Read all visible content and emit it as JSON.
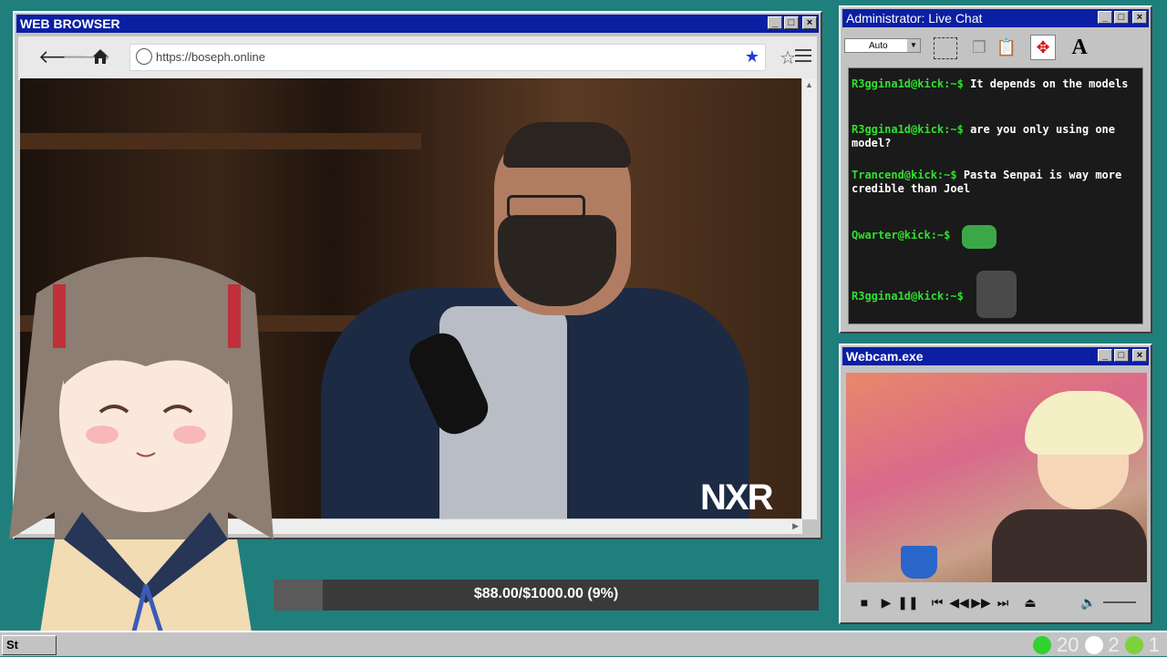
{
  "browser": {
    "title": "WEB BROWSER",
    "url": "https://boseph.online",
    "video_watermark": "NXR"
  },
  "donation": {
    "text": "$88.00/$1000.00 (9%)",
    "fraction": 0.09
  },
  "chat": {
    "title": "Administrator: Live Chat",
    "select_value": "Auto",
    "messages": [
      {
        "user": "R3ggina1d@kick:~$",
        "text": "It depends on the models"
      },
      {
        "user": "R3ggina1d@kick:~$",
        "text": "are you only using one model?"
      },
      {
        "user": "Trancend@kick:~$",
        "text": "Pasta Senpai is way more credible than Joel"
      },
      {
        "user": "Qwarter@kick:~$",
        "text": ""
      },
      {
        "user": "R3ggina1d@kick:~$",
        "text": ""
      }
    ]
  },
  "webcam": {
    "title": "Webcam.exe"
  },
  "taskbar": {
    "start_label": "St",
    "tray": [
      {
        "icon": "kick-icon",
        "value": "20",
        "color": "#2fd22f"
      },
      {
        "icon": "moon-icon",
        "value": "2",
        "color": "#ffffff"
      },
      {
        "icon": "play-icon",
        "value": "1",
        "color": "#7cd23a"
      }
    ]
  }
}
